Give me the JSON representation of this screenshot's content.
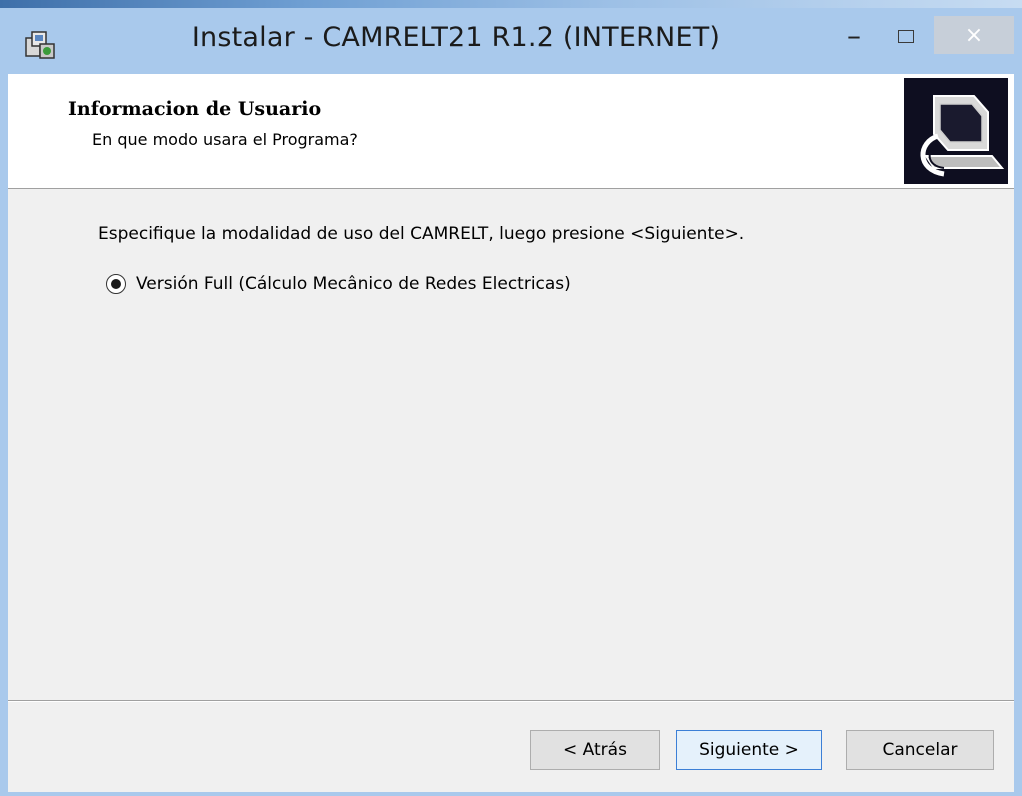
{
  "window": {
    "title": "Instalar - CAMRELT21 R1.2 (INTERNET)",
    "minimize_glyph": "–",
    "close_glyph": "×"
  },
  "header": {
    "title": "Informacion de Usuario",
    "subtitle": "En que modo usara el Programa?"
  },
  "main": {
    "instruction": "Especifique la modalidad de uso del CAMRELT, luego presione <Siguiente>.",
    "option": {
      "label": "Versión Full (Cálculo Mecânico de Redes Electricas)",
      "selected": true
    }
  },
  "buttons": {
    "back": "< Atrás",
    "next": "Siguiente >",
    "cancel": "Cancelar"
  },
  "icons": {
    "app": "installer-icon",
    "header_image": "computer-setup-icon"
  },
  "colors": {
    "titlebar": "#a9c9ec",
    "client": "#f0f0f0",
    "accent": "#3c7fd6"
  }
}
